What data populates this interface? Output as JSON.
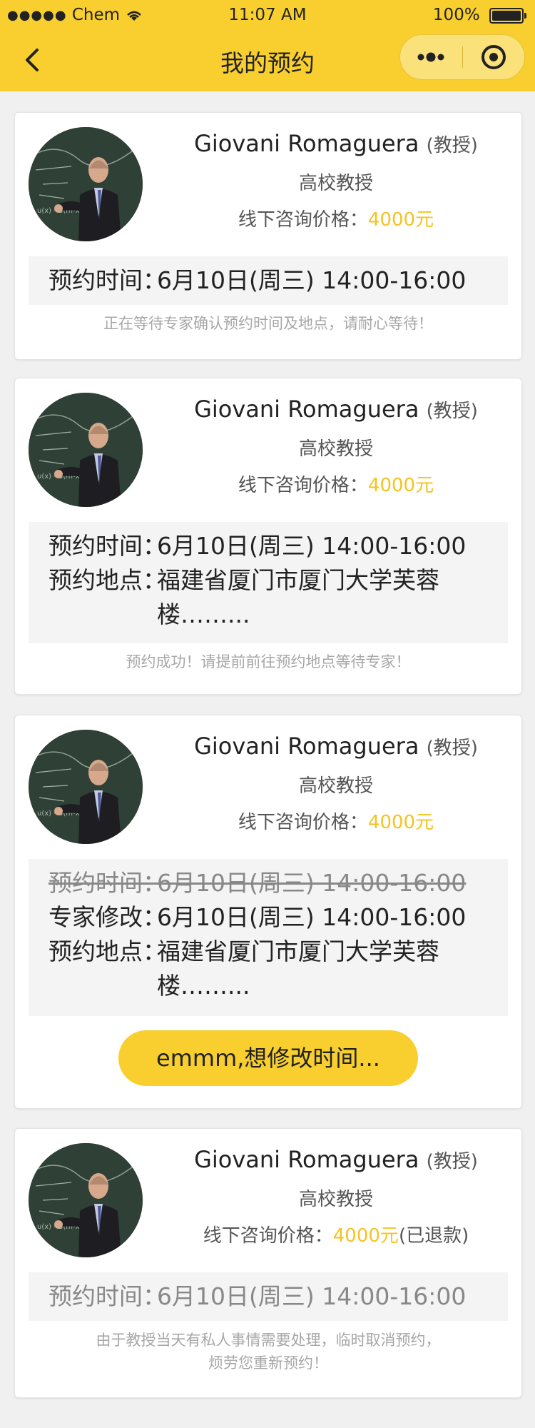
{
  "status_bar": {
    "carrier": "Chem",
    "time": "11:07 AM",
    "battery": "100%"
  },
  "nav": {
    "title": "我的预约"
  },
  "cards": [
    {
      "name": "Giovani Romaguera",
      "title": "(教授)",
      "position": "高校教授",
      "price_label": "线下咨询价格：",
      "price": "4000元",
      "rows": [
        {
          "label": "预约时间：",
          "value": "6月10日(周三) 14:00-16:00"
        }
      ],
      "hint": "正在等待专家确认预约时间及地点，请耐心等待！"
    },
    {
      "name": "Giovani Romaguera",
      "title": "(教授)",
      "position": "高校教授",
      "price_label": "线下咨询价格：",
      "price": "4000元",
      "rows": [
        {
          "label": "预约时间：",
          "value": "6月10日(周三) 14:00-16:00"
        },
        {
          "label": "预约地点：",
          "value": "福建省厦门市厦门大学芙蓉楼……..."
        }
      ],
      "hint": "预约成功！请提前前往预约地点等待专家！"
    },
    {
      "name": "Giovani Romaguera",
      "title": "(教授)",
      "position": "高校教授",
      "price_label": "线下咨询价格：",
      "price": "4000元",
      "rows": [
        {
          "label": "预约时间：",
          "value": "6月10日(周三) 14:00-16:00"
        },
        {
          "label": "专家修改：",
          "value": "6月10日(周三) 14:00-16:00"
        },
        {
          "label": "预约地点：",
          "value": "福建省厦门市厦门大学芙蓉楼……..."
        }
      ],
      "button": "emmm,想修改时间..."
    },
    {
      "name": "Giovani Romaguera",
      "title": "(教授)",
      "position": "高校教授",
      "price_label": "线下咨询价格：",
      "price": "4000元",
      "price_note": "(已退款)",
      "rows": [
        {
          "label": "预约时间：",
          "value": "6月10日(周三) 14:00-16:00"
        }
      ],
      "hint_line1": "由于教授当天有私人事情需要处理，临时取消预约，",
      "hint_line2": "烦劳您重新预约！"
    }
  ],
  "colors": {
    "accent": "#f8cf2e",
    "price": "#f5c322",
    "background": "#f0f0f0"
  }
}
